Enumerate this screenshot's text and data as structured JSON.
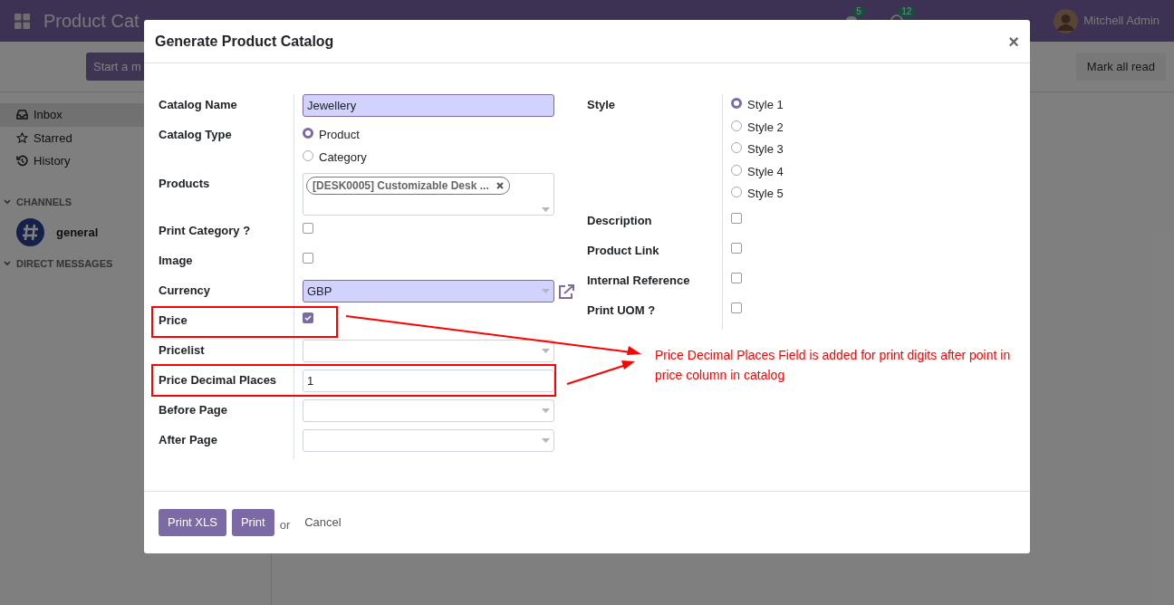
{
  "app_bar": {
    "title": "Product Cat",
    "badges": [
      {
        "kind": "chat",
        "count": "5"
      },
      {
        "kind": "activity",
        "count": "12"
      }
    ],
    "user": "Mitchell Admin"
  },
  "control_bar": {
    "start_button": "Start a m",
    "mark_all_read": "Mark all read"
  },
  "sidebar": {
    "items": [
      {
        "label": "Inbox",
        "kind": "inbox",
        "selected": true
      },
      {
        "label": "Starred",
        "kind": "star",
        "selected": false
      },
      {
        "label": "History",
        "kind": "history",
        "selected": false
      }
    ],
    "channels_header": "CHANNELS",
    "channels": [
      {
        "label": "general"
      }
    ],
    "direct_messages_header": "DIRECT MESSAGES"
  },
  "dialog": {
    "title": "Generate Product Catalog",
    "close": "×",
    "left_fields": [
      {
        "kind": "text",
        "label": "Catalog Name",
        "value": "Jewellery",
        "required": true
      },
      {
        "kind": "radio",
        "label": "Catalog Type",
        "options": [
          {
            "label": "Product",
            "selected": true
          },
          {
            "label": "Category",
            "selected": false
          }
        ]
      },
      {
        "kind": "tags",
        "label": "Products",
        "tags": [
          "[DESK0005] Customizable Desk ..."
        ]
      },
      {
        "kind": "checkbox",
        "label": "Print Category ?",
        "checked": false
      },
      {
        "kind": "checkbox",
        "label": "Image",
        "checked": false
      },
      {
        "kind": "select",
        "label": "Currency",
        "value": "GBP",
        "required": true,
        "external_link": true
      },
      {
        "kind": "checkbox",
        "label": "Price",
        "checked": true
      },
      {
        "kind": "select",
        "label": "Pricelist",
        "required": false
      },
      {
        "kind": "text",
        "label": "Price Decimal Places",
        "value": "1",
        "required": false
      },
      {
        "kind": "select",
        "label": "Before Page",
        "required": false
      },
      {
        "kind": "select",
        "label": "After Page",
        "required": false
      }
    ],
    "right_fields": [
      {
        "kind": "radio",
        "label": "Style",
        "options": [
          {
            "label": "Style 1",
            "selected": true
          },
          {
            "label": "Style 2",
            "selected": false
          },
          {
            "label": "Style 3",
            "selected": false
          },
          {
            "label": "Style 4",
            "selected": false
          },
          {
            "label": "Style 5",
            "selected": false
          }
        ]
      },
      {
        "kind": "checkbox",
        "label": "Description",
        "checked": false
      },
      {
        "kind": "checkbox",
        "label": "Product Link",
        "checked": false
      },
      {
        "kind": "checkbox",
        "label": "Internal Reference",
        "checked": false
      },
      {
        "kind": "checkbox",
        "label": "Print UOM ?",
        "checked": false
      }
    ],
    "buttons": [
      {
        "label": "Print XLS"
      },
      {
        "label": "Print"
      }
    ],
    "separator": "or",
    "cancel": "Cancel"
  },
  "annotation": {
    "text": "Price Decimal Places Field is added for print digits after point in price column in catalog"
  }
}
